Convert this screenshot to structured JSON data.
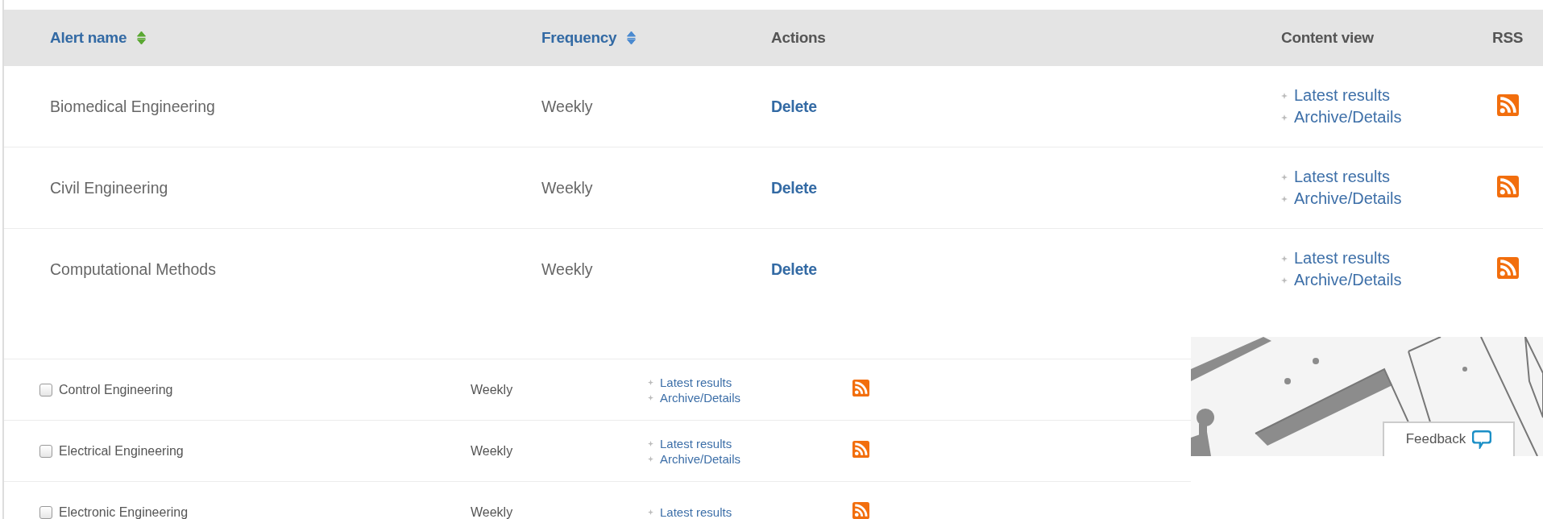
{
  "alerts_table": {
    "columns": [
      {
        "label": "Alert name",
        "kind": "sortable",
        "sorted": true
      },
      {
        "label": "Frequency",
        "kind": "sortable",
        "sorted": false
      },
      {
        "label": "Actions",
        "kind": "plain"
      },
      {
        "label": "Content view",
        "kind": "plain"
      },
      {
        "label": "RSS",
        "kind": "plain"
      }
    ],
    "rows": [
      {
        "name": "Biomedical Engineering",
        "frequency": "Weekly",
        "action": "Delete",
        "links": [
          "Latest results",
          "Archive/Details"
        ]
      },
      {
        "name": "Civil Engineering",
        "frequency": "Weekly",
        "action": "Delete",
        "links": [
          "Latest results",
          "Archive/Details"
        ]
      },
      {
        "name": "Computational Methods",
        "frequency": "Weekly",
        "action": "Delete",
        "links": [
          "Latest results",
          "Archive/Details"
        ]
      }
    ]
  },
  "subscription_list": {
    "rows": [
      {
        "name": "Control Engineering",
        "checked": false,
        "frequency": "Weekly",
        "links": [
          "Latest results",
          "Archive/Details"
        ]
      },
      {
        "name": "Electrical Engineering",
        "checked": false,
        "frequency": "Weekly",
        "links": [
          "Latest results",
          "Archive/Details"
        ]
      },
      {
        "name": "Electronic Engineering",
        "checked": false,
        "frequency": "Weekly",
        "links": [
          "Latest results"
        ]
      }
    ]
  },
  "feedback_button": {
    "label": "Feedback"
  }
}
